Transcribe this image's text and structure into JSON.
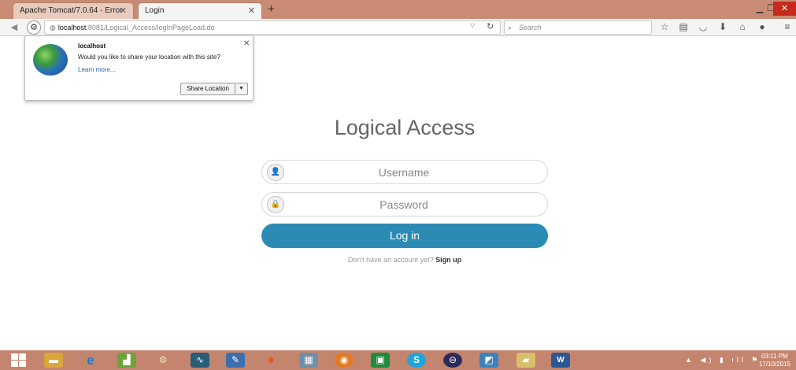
{
  "browser": {
    "tabs": [
      {
        "label": "Apache Tomcat/7.0.64 - Error ...",
        "active": false
      },
      {
        "label": "Login",
        "active": true
      }
    ],
    "tab_close_glyph": "✕",
    "new_tab_glyph": "+",
    "url_host": "localhost",
    "url_rest": ":8081/Logical_Access/logInPageLoad.do",
    "search_placeholder": "Search",
    "toolbar_icons": [
      "star-icon",
      "library-icon",
      "pocket-icon",
      "download-icon",
      "home-icon",
      "chat-icon",
      "menu-icon"
    ]
  },
  "location_prompt": {
    "host": "localhost",
    "question": "Would you like to share your location with this site?",
    "learn_more": "Learn more...",
    "share_button": "Share Location",
    "close_glyph": "✕"
  },
  "login": {
    "title": "Logical Access",
    "username_placeholder": "Username",
    "password_placeholder": "Password",
    "login_button": "Log in",
    "signup_prompt": "Don't have an account yet?",
    "signup_link": "Sign up",
    "accent_color": "#2b8bb5"
  },
  "taskbar": {
    "apps": [
      "file-explorer-icon",
      "internet-explorer-icon",
      "chart-app-icon",
      "tool-app-icon",
      "graph-app-icon",
      "pen-app-icon",
      "media-app-icon",
      "network-app-icon",
      "firefox-icon",
      "store-icon",
      "skype-icon",
      "eclipse-icon",
      "drawing-app-icon",
      "folder-icon",
      "word-icon"
    ],
    "time": "03:11 PM",
    "date": "17/10/2015"
  }
}
